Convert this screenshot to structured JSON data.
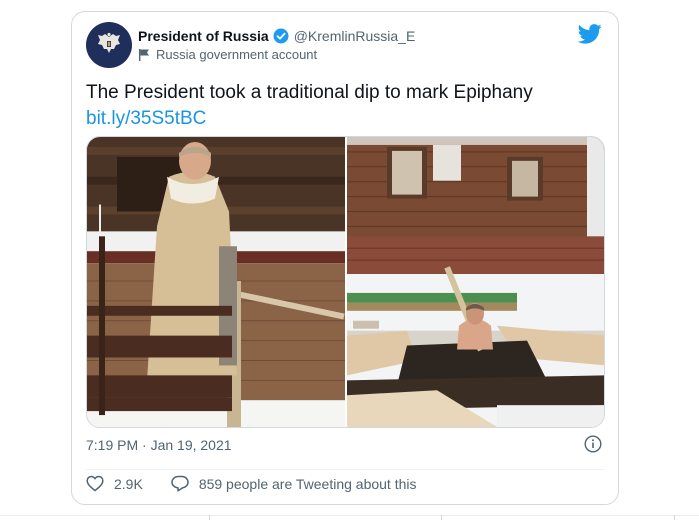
{
  "tweet": {
    "display_name": "President of Russia",
    "handle": "@KremlinRussia_E",
    "account_label": "Russia government account",
    "text": "The President took a traditional dip to mark Epiphany",
    "link": "bit.ly/35S5tBC",
    "timestamp": "7:19 PM · Jan 19, 2021",
    "likes": "2.9K",
    "conversation": "859 people are Tweeting about this"
  },
  "icons": {
    "avatar": "russian-eagle-emblem",
    "verified": "verified-badge-icon",
    "label": "flag-icon",
    "logo": "twitter-bird-icon",
    "info": "info-icon",
    "like": "heart-icon",
    "reply": "speech-bubble-icon"
  },
  "colors": {
    "accent": "#1d9bf0",
    "link": "#1b95e0",
    "text": "#0f1419",
    "secondary": "#536471",
    "border": "#cfd9de",
    "avatar_bg": "#1f2e5a"
  }
}
